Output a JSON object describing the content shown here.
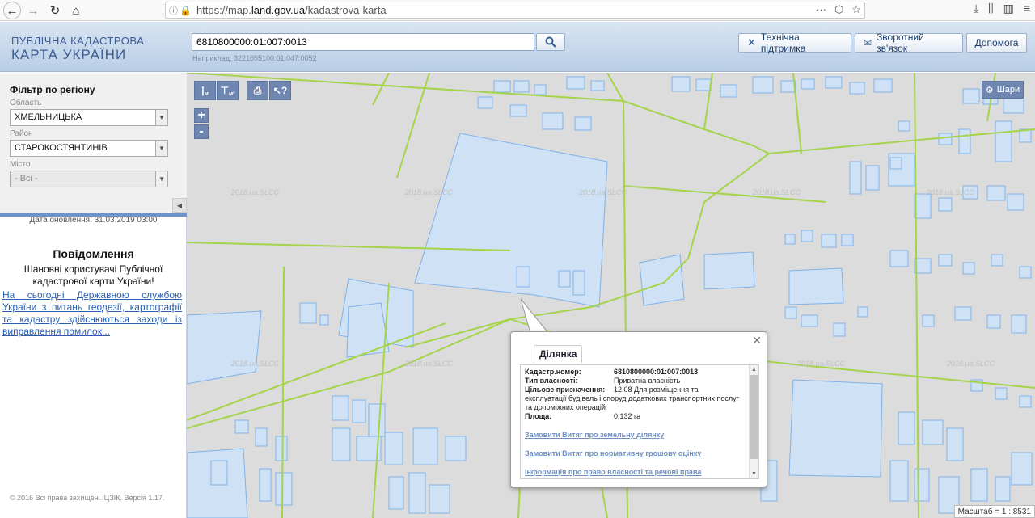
{
  "browser": {
    "url_prefix": "https://map.",
    "url_domain": "land.gov.ua",
    "url_path": "/kadastrova-karta"
  },
  "header": {
    "logo_line1": "ПУБЛІЧНА КАДАСТРОВА",
    "logo_line2": "КАРТА УКРАЇНИ",
    "search_value": "6810800000:01:007:0013",
    "search_hint": "Наприклад: 3221655100:01:047:0052",
    "btn_support": "Технічна підтримка",
    "btn_feedback": "Зворотний зв'язок",
    "btn_help": "Допомога"
  },
  "sidebar": {
    "filter_title": "Фільтр по регіону",
    "oblast_label": "Область",
    "oblast_value": "ХМЕЛЬНИЦЬКА",
    "rayon_label": "Район",
    "rayon_value": "СТАРОКОСТЯНТИНІВ",
    "city_label": "Місто",
    "city_value": "- Всі -",
    "update_date": "Дата оновлення: 31.03.2019 03:00",
    "notice_title": "Повідомлення",
    "notice_greeting": "Шановні користувачі Публічної кадастрової карти України!",
    "notice_link": "На сьогодні Державною службою України з питань геодезії, картографії та кадастру здійснюються заходи із виправлення помилок...",
    "copyright": "© 2016 Всі права захищені. ЦЗІК. Версія 1.17."
  },
  "map": {
    "layers_label": "Шари",
    "watermark": "2018.ua.SLCC",
    "scale": "Масштаб = 1 : 8531",
    "tools": [
      "м",
      "м²"
    ]
  },
  "popup": {
    "tab_label": "Ділянка",
    "rows": [
      {
        "key": "Кадастр.номер:",
        "value": "6810800000:01:007:0013"
      },
      {
        "key": "Тип власності:",
        "value": "Приватна власність"
      },
      {
        "key": "Цільове призначення:",
        "value": "12.08 Для розміщення та"
      },
      {
        "key": "",
        "value": "експлуатації будівель і споруд додаткових транспортних послуг та допоміжних операцій"
      },
      {
        "key": "Площа:",
        "value": "0.132 га"
      }
    ],
    "link1": "Замовити Витяг про земельну ділянку",
    "link2": "Замовити Витяг про нормативну грошову оцінку",
    "link3": "Інформація про право власності та речові права"
  },
  "colors": {
    "parcel_fill": "#cfe1f5",
    "parcel_stroke": "#7fb2e8",
    "boundary": "#a5d34a",
    "map_bg": "#dcdcdc",
    "header_text": "#3b5d93"
  }
}
